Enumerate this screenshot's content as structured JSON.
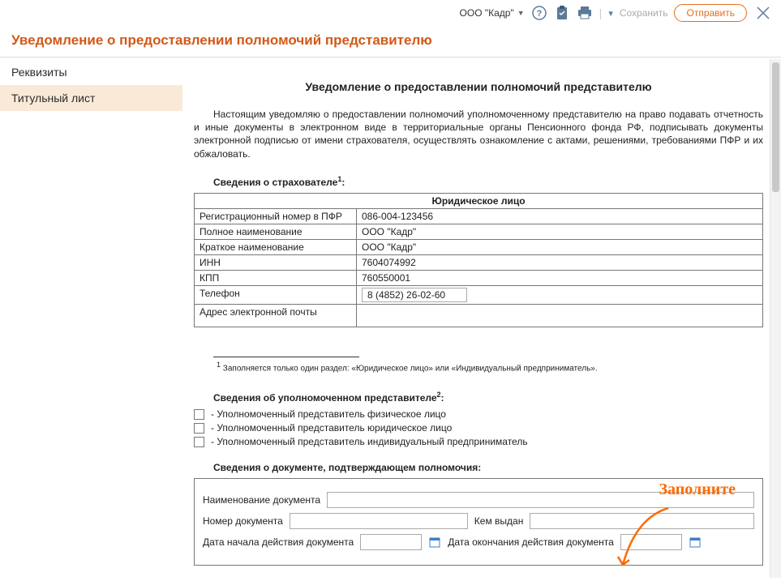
{
  "toolbar": {
    "org_name": "ООО \"Кадр\"",
    "save_label": "Сохранить",
    "send_label": "Отправить"
  },
  "page_title": "Уведомление о предоставлении полномочий представителю",
  "sidebar": {
    "items": [
      {
        "label": "Реквизиты"
      },
      {
        "label": "Титульный лист"
      }
    ]
  },
  "doc": {
    "title": "Уведомление о предоставлении полномочий представителю",
    "body": "Настоящим уведомляю о предоставлении полномочий уполномоченному представителю на право подавать отчетность и иные документы в электронном виде в территориальные органы Пенсионного фонда РФ, подписывать документы электронной подписью от имени страхователя, осуществлять ознакомление с актами, решениями, требованиями ПФР и их обжаловать.",
    "section_insurer": "Сведения о страхователе",
    "insurer_table": {
      "header": "Юридическое лицо",
      "rows": [
        {
          "label": "Регистрационный номер в ПФР",
          "value": "086-004-123456"
        },
        {
          "label": "Полное наименование",
          "value": "ООО \"Кадр\""
        },
        {
          "label": "Краткое наименование",
          "value": "ООО \"Кадр\""
        },
        {
          "label": "ИНН",
          "value": "7604074992"
        },
        {
          "label": "КПП",
          "value": "760550001"
        }
      ],
      "phone_label": "Телефон",
      "phone_value": "8 (4852) 26-02-60",
      "email_label": "Адрес электронной почты",
      "email_value": ""
    },
    "footnote1": "Заполняется только один раздел: «Юридическое лицо» или «Индивидуальный предприниматель».",
    "section_rep": "Сведения об уполномоченном представителе",
    "rep_options": [
      "- Уполномоченный представитель физическое лицо",
      "- Уполномоченный представитель юридическое лицо",
      "- Уполномоченный представитель индивидуальный предприниматель"
    ],
    "section_docinfo": "Сведения о документе, подтверждающем полномочия:",
    "form": {
      "doc_name_label": "Наименование документа",
      "doc_num_label": "Номер документа",
      "issued_by_label": "Кем выдан",
      "start_date_label": "Дата начала действия документа",
      "end_date_label": "Дата окончания действия документа"
    }
  },
  "annotation": "Заполните"
}
